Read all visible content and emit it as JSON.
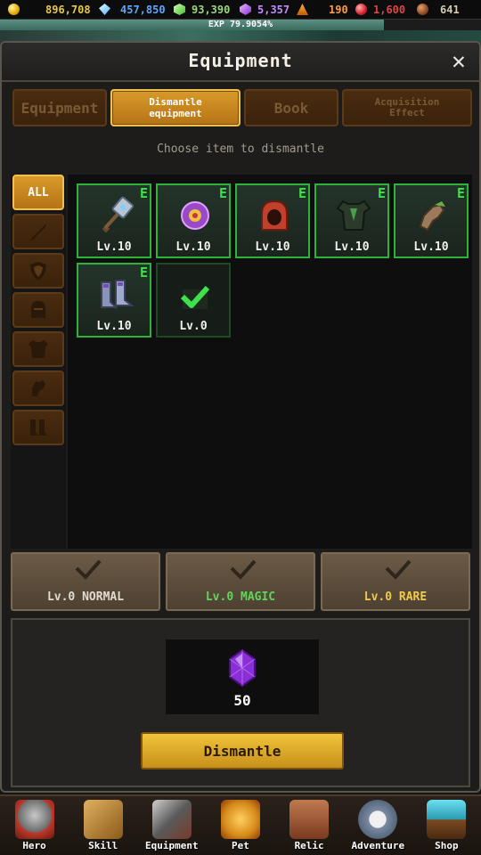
{
  "currencies": [
    {
      "name": "gold",
      "value": "896,708",
      "icon": "gold-coin-icon"
    },
    {
      "name": "diamond",
      "value": "457,850",
      "icon": "diamond-icon"
    },
    {
      "name": "green-gem",
      "value": "93,390",
      "icon": "green-gem-icon"
    },
    {
      "name": "purple-crystal",
      "value": "5,357",
      "icon": "purple-crystal-icon"
    },
    {
      "name": "orange-ore",
      "value": "190",
      "icon": "orange-ore-icon"
    },
    {
      "name": "red-gem",
      "value": "1,600",
      "icon": "red-gem-icon"
    },
    {
      "name": "brown-token",
      "value": "641",
      "icon": "brown-token-icon"
    }
  ],
  "exp": {
    "label": "EXP 79.9054%",
    "progress": 0.799
  },
  "panel": {
    "title": "Equipment"
  },
  "tabs": [
    {
      "label": "Equipment",
      "active": false
    },
    {
      "label": "Dismantle equipment",
      "active": true
    },
    {
      "label": "Book",
      "active": false
    },
    {
      "label": "Acquisition Effect",
      "active": false
    }
  ],
  "hint": "Choose item to dismantle",
  "filters": [
    {
      "label": "ALL",
      "icon": "all-icon",
      "active": true
    },
    {
      "icon": "sword-icon"
    },
    {
      "icon": "shield-icon"
    },
    {
      "icon": "helmet-icon"
    },
    {
      "icon": "armor-icon"
    },
    {
      "icon": "gloves-icon"
    },
    {
      "icon": "boots-icon"
    }
  ],
  "items": [
    {
      "name": "warhammer",
      "level": "Lv.10",
      "equipped": "E",
      "icon": "hammer-icon"
    },
    {
      "name": "purple-orb",
      "level": "Lv.10",
      "equipped": "E",
      "icon": "orb-icon"
    },
    {
      "name": "red-hood",
      "level": "Lv.10",
      "equipped": "E",
      "icon": "hood-icon"
    },
    {
      "name": "dark-armor",
      "level": "Lv.10",
      "equipped": "E",
      "icon": "armor-icon"
    },
    {
      "name": "gauntlet",
      "level": "Lv.10",
      "equipped": "E",
      "icon": "gauntlet-icon"
    },
    {
      "name": "boots",
      "level": "Lv.10",
      "equipped": "E",
      "icon": "boots-icon"
    },
    {
      "name": "selected-item",
      "level": "Lv.0",
      "equipped": "",
      "icon": "check-icon"
    }
  ],
  "rarity_buttons": [
    {
      "label": "Lv.0 NORMAL",
      "class": "normal"
    },
    {
      "label": "Lv.0 MAGIC",
      "class": "magic"
    },
    {
      "label": "Lv.0 RARE",
      "class": "rare"
    }
  ],
  "reward": {
    "amount": "50",
    "icon": "purple-crystal-icon"
  },
  "dismantle_button": "Dismantle",
  "nav": [
    {
      "label": "Hero",
      "icon": "hero-icon",
      "color": "#c0392b"
    },
    {
      "label": "Skill",
      "icon": "skill-book-icon",
      "color": "#b07a2a"
    },
    {
      "label": "Equipment",
      "icon": "equipment-icon",
      "color": "#8a8a8a"
    },
    {
      "label": "Pet",
      "icon": "pet-icon",
      "color": "#d68a1a"
    },
    {
      "label": "Relic",
      "icon": "relic-chest-icon",
      "color": "#a0523a"
    },
    {
      "label": "Adventure",
      "icon": "compass-icon",
      "color": "#7a8aa0"
    },
    {
      "label": "Shop",
      "icon": "shop-chest-icon",
      "color": "#2a9ab0"
    }
  ]
}
